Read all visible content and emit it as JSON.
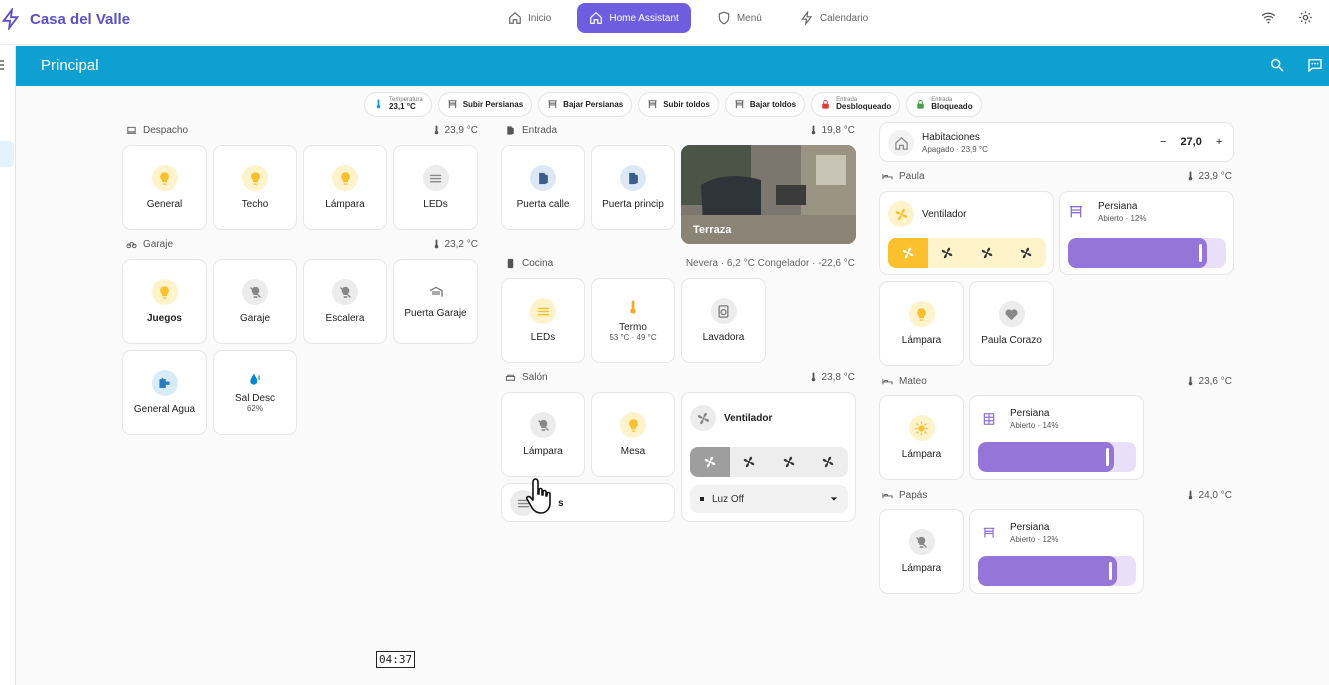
{
  "app": {
    "brand": "Casa del Valle"
  },
  "nav": {
    "tabs": [
      {
        "label": "Inicio",
        "icon": "home-icon"
      },
      {
        "label": "Home Assistant",
        "icon": "home-icon",
        "active": true
      },
      {
        "label": "Menú",
        "icon": "shield-icon"
      },
      {
        "label": "Calendario",
        "icon": "bolt-icon"
      }
    ]
  },
  "appbar": {
    "title": "Principal"
  },
  "chips": {
    "temp": {
      "small": "Temperatura",
      "value": "23,1 °C"
    },
    "subir_persianas": "Subir Persianas",
    "bajar_persianas": "Bajar Persianas",
    "subir_toldos": "Subir toldos",
    "bajar_toldos": "Bajar toldos",
    "entrada1": {
      "small": "Entrada",
      "value": "Desbloqueado"
    },
    "entrada2": {
      "small": "Entrada",
      "value": "Bloqueado"
    }
  },
  "despacho": {
    "title": "Despacho",
    "temp": "23,9 °C",
    "tiles": [
      "General",
      "Techo",
      "Lámpara",
      "LEDs"
    ]
  },
  "garaje": {
    "title": "Garaje",
    "temp": "23,2 °C",
    "tiles": [
      "Juegos",
      "Garaje",
      "Escalera",
      "Puerta Garaje",
      "General Agua",
      "Sal Desc"
    ],
    "sal_desc_sub": "62%"
  },
  "entrada": {
    "title": "Entrada",
    "temp": "19,8 °C",
    "tiles": [
      "Puerta calle",
      "Puerta princip"
    ],
    "camera": "Terraza"
  },
  "cocina": {
    "title": "Cocina",
    "info": "Nevera · 6,2 °C  Congelador · -22,6 °C",
    "tiles": [
      "LEDs",
      "Termo",
      "Lavadora"
    ],
    "termo_sub": "53 °C · 49 °C"
  },
  "salon": {
    "title": "Salón",
    "temp": "23,8 °C",
    "tiles": [
      "Lámpara",
      "Mesa"
    ],
    "partial": "s",
    "fan": {
      "name": "Ventilador",
      "select": "Luz Off"
    }
  },
  "habitaciones": {
    "title": "Habitaciones",
    "state": "Apagado · 23,9 °C",
    "value": "27,0",
    "minus": "−",
    "plus": "+"
  },
  "paula": {
    "title": "Paula",
    "temp": "23,9 °C",
    "fan": "Ventilador",
    "persiana": {
      "name": "Persiana",
      "state": "Abierto · 12%",
      "level": 0.88
    },
    "tiles": [
      "Lámpara",
      "Paula Corazo"
    ]
  },
  "mateo": {
    "title": "Mateo",
    "temp": "23,6 °C",
    "tile": "Lámpara",
    "persiana": {
      "name": "Persiana",
      "state": "Abierto · 14%",
      "level": 0.86
    }
  },
  "papas": {
    "title": "Papás",
    "temp": "24,0 °C",
    "tile": "Lámpara",
    "persiana": {
      "name": "Persiana",
      "state": "Abierto · 12%",
      "level": 0.88
    }
  },
  "timer": "04:37",
  "colors": {
    "accent": "#6f5de0",
    "appbar": "#0fa0d2",
    "yellow": "#fbc02d",
    "slider": "#9575d8"
  }
}
